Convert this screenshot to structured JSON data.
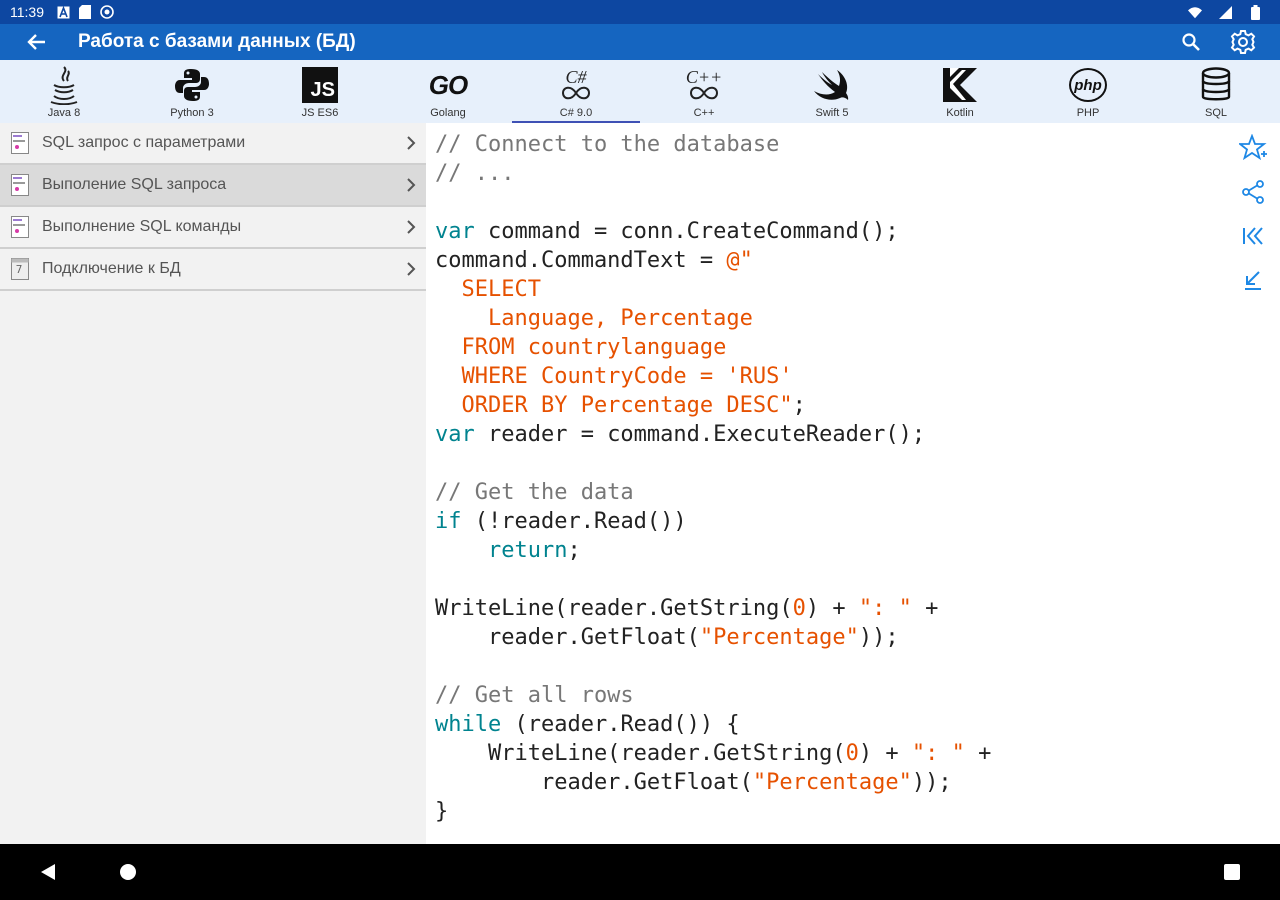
{
  "status": {
    "time": "11:39"
  },
  "toolbar": {
    "title": "Работа с базами данных (БД)"
  },
  "languages": [
    {
      "label": "Java 8",
      "icon": "java-icon"
    },
    {
      "label": "Python 3",
      "icon": "python-icon"
    },
    {
      "label": "JS ES6",
      "icon": "js-icon",
      "glyph": "JS"
    },
    {
      "label": "Golang",
      "icon": "go-icon",
      "glyph": "GO"
    },
    {
      "label": "C# 9.0",
      "icon": "csharp-icon",
      "glyph": "C#",
      "active": true
    },
    {
      "label": "C++",
      "icon": "cpp-icon",
      "glyph": "C++"
    },
    {
      "label": "Swift 5",
      "icon": "swift-icon"
    },
    {
      "label": "Kotlin",
      "icon": "kotlin-icon"
    },
    {
      "label": "PHP",
      "icon": "php-icon",
      "glyph": "php"
    },
    {
      "label": "SQL",
      "icon": "database-icon"
    }
  ],
  "sidebar": {
    "items": [
      {
        "label": "SQL запрос с параметрами",
        "icon": "code-file-icon"
      },
      {
        "label": "Выполение SQL запроса",
        "icon": "code-file-icon",
        "selected": true
      },
      {
        "label": "Выполнение SQL команды",
        "icon": "code-file-icon"
      },
      {
        "label": "Подключение к БД",
        "icon": "notepad-icon",
        "icon_text": "7"
      }
    ]
  },
  "code": {
    "lines": [
      [
        [
          "cm",
          "// Connect to the database"
        ]
      ],
      [
        [
          "cm",
          "// ..."
        ]
      ],
      [],
      [
        [
          "kw",
          "var"
        ],
        [
          "",
          "command = conn.CreateCommand();"
        ]
      ],
      [
        [
          "",
          "command.CommandText = "
        ],
        [
          "st",
          "@\""
        ]
      ],
      [
        [
          "st",
          "  SELECT"
        ]
      ],
      [
        [
          "st",
          "    Language, Percentage"
        ]
      ],
      [
        [
          "st",
          "  FROM countrylanguage"
        ]
      ],
      [
        [
          "st",
          "  WHERE CountryCode = 'RUS'"
        ]
      ],
      [
        [
          "st",
          "  ORDER BY Percentage DESC\""
        ],
        [
          "",
          ";"
        ]
      ],
      [
        [
          "kw",
          "var"
        ],
        [
          "",
          "reader = command.ExecuteReader();"
        ]
      ],
      [],
      [
        [
          "cm",
          "// Get the data"
        ]
      ],
      [
        [
          "kw",
          "if"
        ],
        [
          "",
          " (!reader.Read())"
        ]
      ],
      [
        [
          "",
          "    "
        ],
        [
          "kw",
          "return"
        ],
        [
          "",
          ";"
        ]
      ],
      [],
      [
        [
          "",
          "WriteLine(reader.GetString("
        ],
        [
          "num",
          "0"
        ],
        [
          "",
          ") + "
        ],
        [
          "st",
          "\": \""
        ],
        [
          "",
          " +"
        ]
      ],
      [
        [
          "",
          "    reader.GetFloat("
        ],
        [
          "st",
          "\"Percentage\""
        ],
        [
          "",
          "));"
        ]
      ],
      [],
      [
        [
          "cm",
          "// Get all rows"
        ]
      ],
      [
        [
          "kw",
          "while"
        ],
        [
          "",
          " (reader.Read()) {"
        ]
      ],
      [
        [
          "",
          "    WriteLine(reader.GetString("
        ],
        [
          "num",
          "0"
        ],
        [
          "",
          ") + "
        ],
        [
          "st",
          "\": \""
        ],
        [
          "",
          " +"
        ]
      ],
      [
        [
          "",
          "        reader.GetFloat("
        ],
        [
          "st",
          "\"Percentage\""
        ],
        [
          "",
          "));"
        ]
      ],
      [
        [
          "",
          "}"
        ]
      ]
    ]
  },
  "colors": {
    "statusbar": "#0d47a1",
    "toolbar": "#1565c0",
    "accent": "#3f51b5",
    "comment": "#777777",
    "keyword": "#00838f",
    "string": "#e65100"
  }
}
